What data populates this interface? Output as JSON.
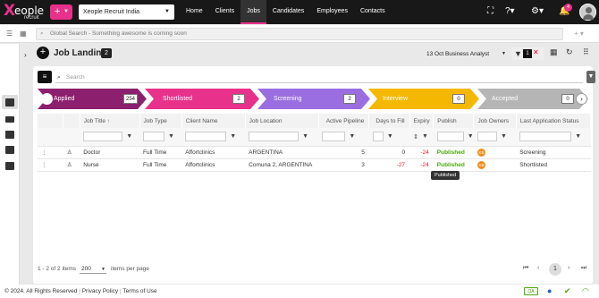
{
  "header": {
    "logo_x": "X",
    "logo_text": "eople",
    "logo_sub": "recruit",
    "plus": "+",
    "company": "Xeople Recruit India",
    "nav": [
      "Home",
      "Clients",
      "Jobs",
      "Candidates",
      "Employees",
      "Contacts"
    ],
    "active_nav": "Jobs",
    "notifications": "4"
  },
  "global_search": {
    "placeholder": "Global Search - Something awesome is coming soon"
  },
  "page": {
    "title": "Job Landing",
    "count": "2",
    "job_selector": "13 Oct Business Analyst",
    "filter_count": "1",
    "search_placeholder": "Search"
  },
  "pipeline": [
    {
      "label": "Applied",
      "count": "254",
      "color": "#8c1f6e"
    },
    {
      "label": "Shortlisted",
      "count": "2",
      "color": "#e8318a"
    },
    {
      "label": "Screening",
      "count": "2",
      "color": "#9a6ee0"
    },
    {
      "label": "Interview",
      "count": "0",
      "color": "#f5b800"
    },
    {
      "label": "Accepted",
      "count": "0",
      "color": "#b5b5b5"
    }
  ],
  "table": {
    "headers": [
      "Job Title ↑",
      "Job Type",
      "Client Name",
      "Job Location",
      "Active Pipeline",
      "Days to Fill",
      "Expiry",
      "Publish",
      "Job Owners",
      "Last Application Status"
    ],
    "rows": [
      {
        "title": "Doctor",
        "type": "Full Time",
        "client": "Affortclinics",
        "location": "ARGENTINA",
        "pipeline": "5",
        "days": "0",
        "expiry": "-24",
        "publish": "Published",
        "owner": "KB",
        "status": "Screening"
      },
      {
        "title": "Nurse",
        "type": "Full Time",
        "client": "Affortclinics",
        "location": "Comuna 2, ARGENTINA",
        "pipeline": "3",
        "days": "-27",
        "expiry": "-24",
        "publish": "Published",
        "owner": "KB",
        "status": "Shortlisted"
      }
    ],
    "tooltip": "Published"
  },
  "pagination": {
    "summary": "1 - 2 of 2 items",
    "page_size": "200",
    "per_page_label": "items per page",
    "current": "1"
  },
  "footer": {
    "copyright": "© 2024. All Rights Reserved",
    "privacy": "Privacy Policy",
    "terms": "Terms of Use",
    "qa": "QA"
  }
}
